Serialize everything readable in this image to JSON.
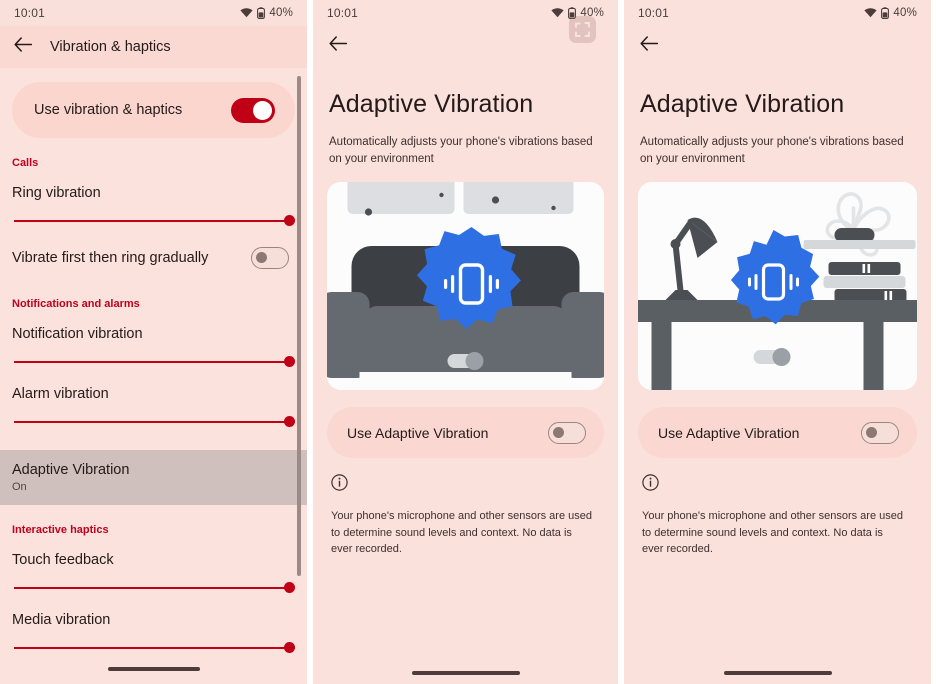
{
  "status_bar": {
    "time": "10:01",
    "battery": "40%",
    "wifi_icon": "wifi-icon",
    "battery_icon": "battery-icon"
  },
  "colors": {
    "page_bg": "#fbe1dc",
    "card_bg": "#fbd6cf",
    "accent_red": "#c00014",
    "section_label": "#c0001f",
    "selected_row": "#cfc0bd",
    "badge_blue": "#2f6fe4",
    "text_primary": "#241a19"
  },
  "panel1": {
    "app_bar": {
      "back_icon": "back-arrow-icon",
      "title": "Vibration & haptics"
    },
    "master_toggle": {
      "label": "Use vibration & haptics",
      "state": "on"
    },
    "sections": [
      {
        "heading": "Calls",
        "items": [
          {
            "type": "slider",
            "label": "Ring vibration",
            "value": 100
          },
          {
            "type": "switch",
            "label": "Vibrate first then ring gradually",
            "state": "off"
          }
        ]
      },
      {
        "heading": "Notifications and alarms",
        "items": [
          {
            "type": "slider",
            "label": "Notification vibration",
            "value": 100
          },
          {
            "type": "slider",
            "label": "Alarm vibration",
            "value": 100
          }
        ]
      }
    ],
    "selected_item": {
      "title": "Adaptive Vibration",
      "subtitle": "On"
    },
    "section_interactive": {
      "heading": "Interactive haptics",
      "items": [
        {
          "type": "slider",
          "label": "Touch feedback",
          "value": 100
        },
        {
          "type": "slider",
          "label": "Media vibration",
          "value": 100
        }
      ]
    }
  },
  "panel2": {
    "back_icon": "back-arrow-icon",
    "fullscreen_icon": "fullscreen-icon",
    "title": "Adaptive Vibration",
    "subtitle": "Automatically adjusts your phone's vibrations based on your environment",
    "illustration": "couch-vibration-illustration",
    "toggle": {
      "label": "Use Adaptive Vibration",
      "state": "off"
    },
    "info_icon": "info-icon",
    "info_text": "Your phone's microphone and other sensors are used to determine sound levels and context. No data is ever recorded."
  },
  "panel3": {
    "back_icon": "back-arrow-icon",
    "title": "Adaptive Vibration",
    "subtitle": "Automatically adjusts your phone's vibrations based on your environment",
    "illustration": "desk-vibration-illustration",
    "toggle": {
      "label": "Use Adaptive Vibration",
      "state": "off"
    },
    "info_icon": "info-icon",
    "info_text": "Your phone's microphone and other sensors are used to determine sound levels and context. No data is ever recorded."
  }
}
